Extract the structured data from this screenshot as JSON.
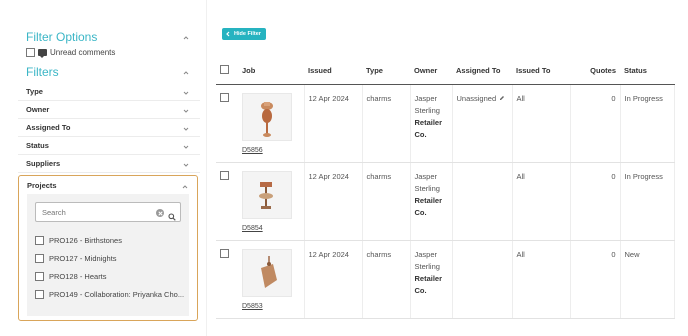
{
  "sidebar": {
    "filter_options_title": "Filter Options",
    "unread_label": "Unread comments",
    "filters_title": "Filters",
    "filters": [
      {
        "label": "Type"
      },
      {
        "label": "Owner"
      },
      {
        "label": "Assigned To"
      },
      {
        "label": "Status"
      },
      {
        "label": "Suppliers"
      }
    ],
    "projects": {
      "label": "Projects",
      "search_placeholder": "Search",
      "items": [
        {
          "label": "PRO126 - Birthstones"
        },
        {
          "label": "PRO127 - Midnights"
        },
        {
          "label": "PRO128 - Hearts"
        },
        {
          "label": "PRO149 - Collaboration: Priyanka Cho..."
        }
      ]
    }
  },
  "toolbar": {
    "hide_filter_label": "Hide Filter"
  },
  "table": {
    "headers": {
      "job": "Job",
      "issued": "Issued",
      "type": "Type",
      "owner": "Owner",
      "assigned_to": "Assigned To",
      "issued_to": "Issued To",
      "quotes": "Quotes",
      "status": "Status"
    },
    "rows": [
      {
        "job": "D5856",
        "issued": "12 Apr 2024",
        "type": "charms",
        "owner_name": "Jasper Sterling",
        "owner_co": "Retailer Co.",
        "assigned": "Unassigned",
        "issued_to": "All",
        "quotes": "0",
        "status": "In Progress"
      },
      {
        "job": "D5854",
        "issued": "12 Apr 2024",
        "type": "charms",
        "owner_name": "Jasper Sterling",
        "owner_co": "Retailer Co.",
        "assigned": "",
        "issued_to": "All",
        "quotes": "0",
        "status": "In Progress"
      },
      {
        "job": "D5853",
        "issued": "12 Apr 2024",
        "type": "charms",
        "owner_name": "Jasper Sterling",
        "owner_co": "Retailer Co.",
        "assigned": "",
        "issued_to": "All",
        "quotes": "0",
        "status": "New"
      }
    ]
  },
  "colors": {
    "accent": "#26b3c0",
    "heading": "#3bb6c6",
    "highlight_border": "#d9a55a"
  },
  "icons": [
    "chevron-up-icon",
    "chevron-down-icon",
    "comment-icon",
    "clear-icon",
    "search-icon",
    "chevron-left-icon",
    "pencil-icon"
  ]
}
